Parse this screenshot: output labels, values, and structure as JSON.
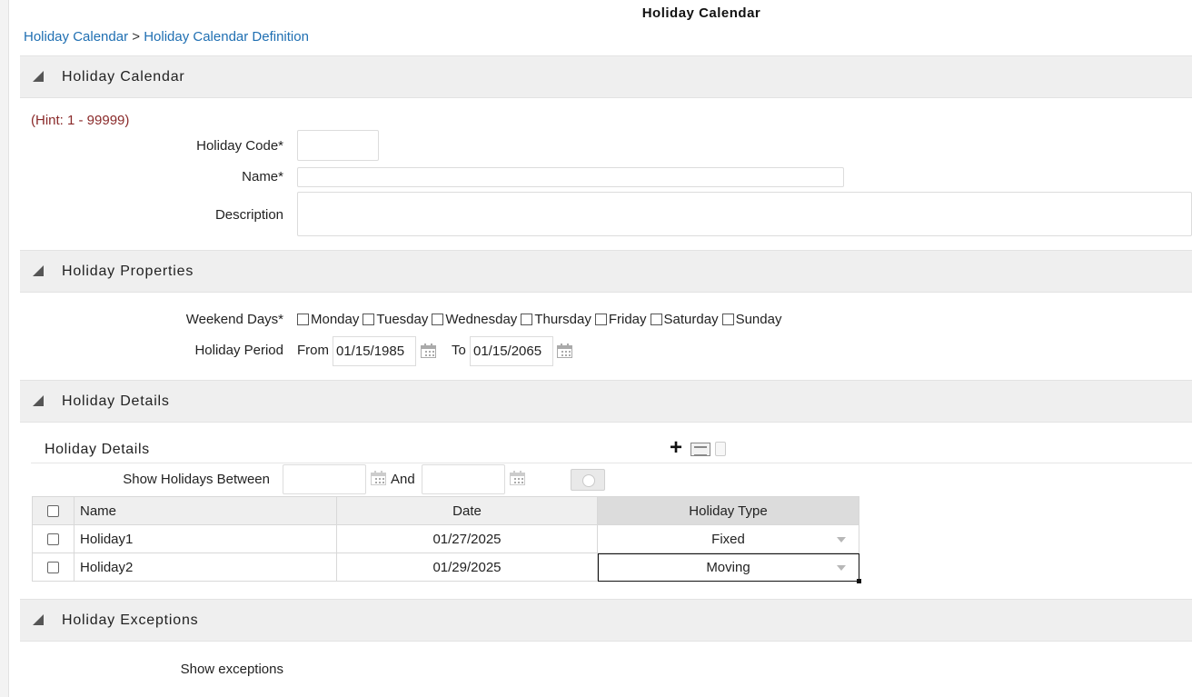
{
  "page": {
    "title": "Holiday Calendar"
  },
  "breadcrumb": {
    "root": "Holiday Calendar",
    "separator": " > ",
    "current": "Holiday Calendar Definition"
  },
  "sections": {
    "calendar": "Holiday Calendar",
    "properties": "Holiday Properties",
    "details": "Holiday Details",
    "exceptions": "Holiday Exceptions"
  },
  "calendar_form": {
    "hint": "(Hint: 1 - 99999)",
    "code_label": "Holiday Code*",
    "code_value": "",
    "name_label": "Name*",
    "name_value": "",
    "description_label": "Description",
    "description_value": ""
  },
  "properties_form": {
    "weekend_label": "Weekend Days*",
    "weekend_days": [
      {
        "label": "Monday",
        "checked": false
      },
      {
        "label": "Tuesday",
        "checked": false
      },
      {
        "label": "Wednesday",
        "checked": false
      },
      {
        "label": "Thursday",
        "checked": false
      },
      {
        "label": "Friday",
        "checked": false
      },
      {
        "label": "Saturday",
        "checked": false
      },
      {
        "label": "Sunday",
        "checked": false
      }
    ],
    "period_label": "Holiday Period",
    "from_label": "From",
    "from_value": "01/15/1985",
    "to_label": "To",
    "to_value": "01/15/2065"
  },
  "details": {
    "subheading": "Holiday Details",
    "toolbar": {
      "add_icon": "plus-icon",
      "edit_icon": "grid-edit-icon",
      "delete_icon": "trash-icon"
    },
    "filter_label": "Show Holidays Between",
    "filter_and": "And",
    "filter_from": "",
    "filter_to": "",
    "columns": [
      "Name",
      "Date",
      "Holiday Type"
    ],
    "rows": [
      {
        "name": "Holiday1",
        "date": "01/27/2025",
        "type": "Fixed"
      },
      {
        "name": "Holiday2",
        "date": "01/29/2025",
        "type": "Moving"
      }
    ]
  },
  "exceptions": {
    "show_label": "Show exceptions"
  }
}
